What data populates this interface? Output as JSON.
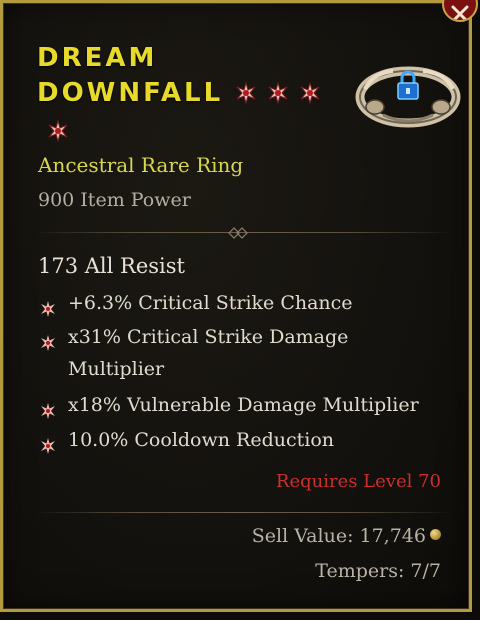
{
  "item": {
    "name_line1": "DREAM",
    "name_line2": "DOWNFALL",
    "rarity": "Ancestral Rare Ring",
    "item_power": "900 Item Power",
    "implicit": "173 All Resist",
    "affixes": [
      "+6.3% Critical Strike Chance",
      "x31% Critical Strike Damage Multiplier",
      "x18% Vulnerable Damage Multiplier",
      "10.0% Cooldown Reduction"
    ],
    "requirement": "Requires Level 70",
    "sell_value": "Sell Value: 17,746",
    "tempers": "Tempers: 7/7",
    "ancestral_star_count": 4
  },
  "icons": {
    "close": "close-icon",
    "ring": "ring-icon",
    "lock": "lock-icon",
    "gold": "gold-coin-icon",
    "star": "ancestral-star-icon",
    "bullet": "affix-bullet-icon"
  },
  "colors": {
    "title": "#e7da2a",
    "rarity": "#d7d74b",
    "requirement": "#c82f2f",
    "border": "#b39a3c",
    "lock": "#3fa9ff"
  }
}
